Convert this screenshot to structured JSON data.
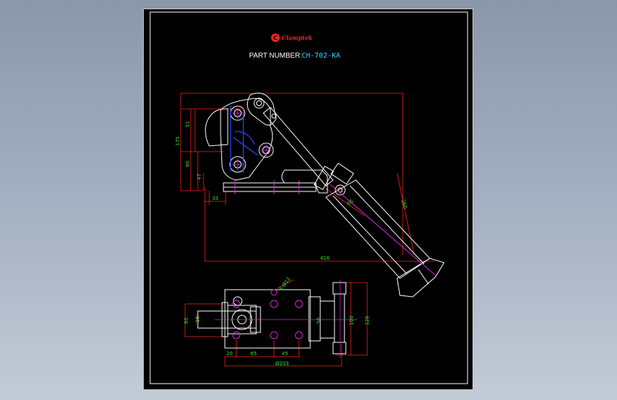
{
  "brand": {
    "name": "Clamptek",
    "logo_letter": "C"
  },
  "title": {
    "part_number_label": "PART NUMBER:",
    "part_number_value": "CH-702-KA"
  },
  "colors": {
    "viewport_bg": "#95a2b5",
    "sheet_bg": "#000000",
    "border": "#ffffff",
    "dimension_line": "#ff2020",
    "dimension_text": "#2ee52e",
    "outline": "#ffffff",
    "hidden": "#2a4cff",
    "center": "#e020e0",
    "brand": "#ff2020",
    "part_number": "#2fd6ff"
  },
  "dimensions": {
    "side_view": {
      "overall_height": "175",
      "upper_height": "51",
      "mid_height": "90",
      "base_height": "47",
      "base_offset": "33",
      "overall_length": "416",
      "handle_length": "260",
      "angle": "66"
    },
    "top_view": {
      "hole_callout": "6-Ø12",
      "width_left": "60",
      "slot": "16",
      "hole_spacing": "50",
      "inner_width": "100",
      "outer_width": "126",
      "edge": "20",
      "pitch_a": "65",
      "pitch_b": "45",
      "total_length": "Ø203"
    }
  }
}
